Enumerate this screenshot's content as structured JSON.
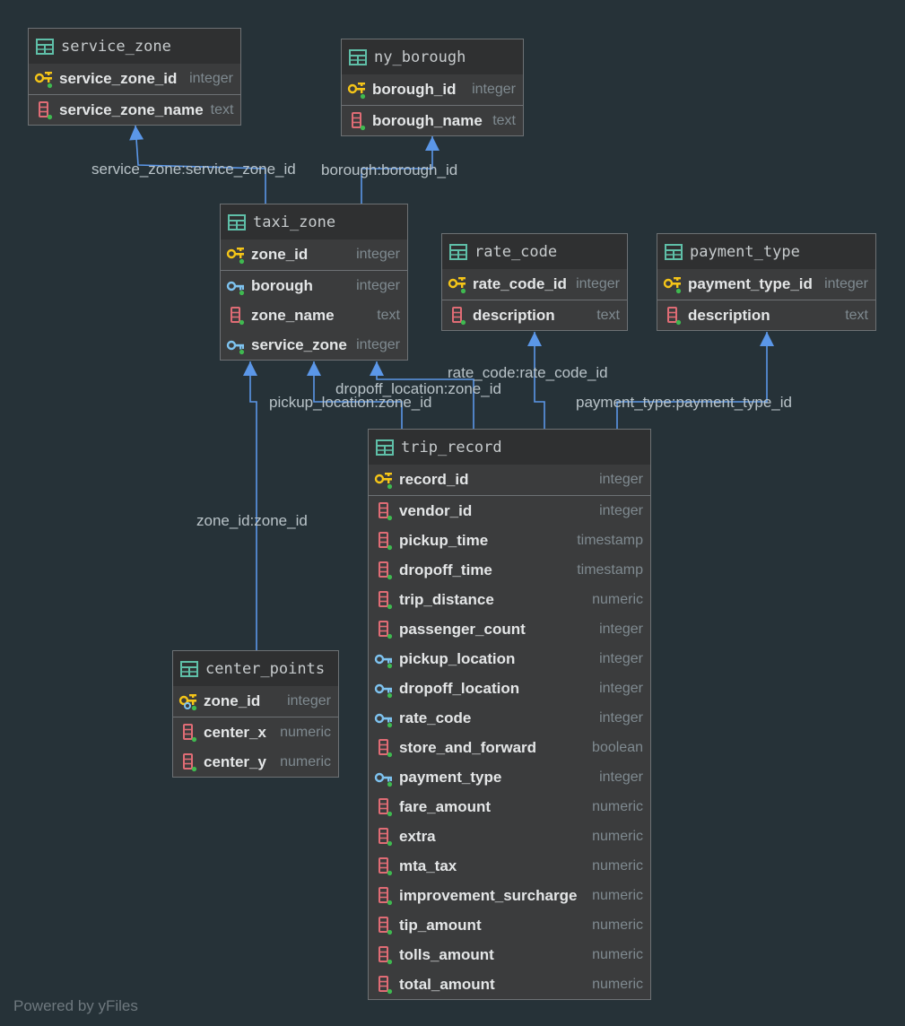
{
  "tables": [
    {
      "key": "service_zone",
      "title": "service_zone",
      "columns": [
        {
          "name": "service_zone_id",
          "type": "integer",
          "kind": "pk"
        },
        {
          "name": "service_zone_name",
          "type": "text",
          "kind": "col"
        }
      ]
    },
    {
      "key": "ny_borough",
      "title": "ny_borough",
      "columns": [
        {
          "name": "borough_id",
          "type": "integer",
          "kind": "pk"
        },
        {
          "name": "borough_name",
          "type": "text",
          "kind": "col"
        }
      ]
    },
    {
      "key": "taxi_zone",
      "title": "taxi_zone",
      "columns": [
        {
          "name": "zone_id",
          "type": "integer",
          "kind": "pk"
        },
        {
          "name": "borough",
          "type": "integer",
          "kind": "fk"
        },
        {
          "name": "zone_name",
          "type": "text",
          "kind": "col"
        },
        {
          "name": "service_zone",
          "type": "integer",
          "kind": "fk"
        }
      ]
    },
    {
      "key": "rate_code",
      "title": "rate_code",
      "columns": [
        {
          "name": "rate_code_id",
          "type": "integer",
          "kind": "pk"
        },
        {
          "name": "description",
          "type": "text",
          "kind": "col"
        }
      ]
    },
    {
      "key": "payment_type",
      "title": "payment_type",
      "columns": [
        {
          "name": "payment_type_id",
          "type": "integer",
          "kind": "pk"
        },
        {
          "name": "description",
          "type": "text",
          "kind": "col"
        }
      ]
    },
    {
      "key": "trip_record",
      "title": "trip_record",
      "columns": [
        {
          "name": "record_id",
          "type": "integer",
          "kind": "pk"
        },
        {
          "name": "vendor_id",
          "type": "integer",
          "kind": "col"
        },
        {
          "name": "pickup_time",
          "type": "timestamp",
          "kind": "col"
        },
        {
          "name": "dropoff_time",
          "type": "timestamp",
          "kind": "col"
        },
        {
          "name": "trip_distance",
          "type": "numeric",
          "kind": "col"
        },
        {
          "name": "passenger_count",
          "type": "integer",
          "kind": "col"
        },
        {
          "name": "pickup_location",
          "type": "integer",
          "kind": "fk"
        },
        {
          "name": "dropoff_location",
          "type": "integer",
          "kind": "fk"
        },
        {
          "name": "rate_code",
          "type": "integer",
          "kind": "fk"
        },
        {
          "name": "store_and_forward",
          "type": "boolean",
          "kind": "col"
        },
        {
          "name": "payment_type",
          "type": "integer",
          "kind": "fk"
        },
        {
          "name": "fare_amount",
          "type": "numeric",
          "kind": "col"
        },
        {
          "name": "extra",
          "type": "numeric",
          "kind": "col"
        },
        {
          "name": "mta_tax",
          "type": "numeric",
          "kind": "col"
        },
        {
          "name": "improvement_surcharge",
          "type": "numeric",
          "kind": "col"
        },
        {
          "name": "tip_amount",
          "type": "numeric",
          "kind": "col"
        },
        {
          "name": "tolls_amount",
          "type": "numeric",
          "kind": "col"
        },
        {
          "name": "total_amount",
          "type": "numeric",
          "kind": "col"
        }
      ]
    },
    {
      "key": "center_points",
      "title": "center_points",
      "columns": [
        {
          "name": "zone_id",
          "type": "integer",
          "kind": "pkfk"
        },
        {
          "name": "center_x",
          "type": "numeric",
          "kind": "col"
        },
        {
          "name": "center_y",
          "type": "numeric",
          "kind": "col"
        }
      ]
    }
  ],
  "relations": [
    {
      "key": "sz",
      "from": "taxi_zone",
      "to": "service_zone",
      "label": "service_zone:service_zone_id"
    },
    {
      "key": "bo",
      "from": "taxi_zone",
      "to": "ny_borough",
      "label": "borough:borough_id"
    },
    {
      "key": "rc",
      "from": "trip_record",
      "to": "rate_code",
      "label": "rate_code:rate_code_id"
    },
    {
      "key": "dl",
      "from": "trip_record",
      "to": "taxi_zone",
      "label": "dropoff_location:zone_id"
    },
    {
      "key": "pl",
      "from": "trip_record",
      "to": "taxi_zone",
      "label": "pickup_location:zone_id"
    },
    {
      "key": "pt",
      "from": "trip_record",
      "to": "payment_type",
      "label": "payment_type:payment_type_id"
    },
    {
      "key": "zi",
      "from": "center_points",
      "to": "taxi_zone",
      "label": "zone_id:zone_id"
    }
  ],
  "footer": "Powered by yFiles",
  "colors": {
    "background": "#263238",
    "edge": "#5b97e8",
    "pk_key": "#f5c518",
    "fk_key": "#7ec3f0",
    "column": "#e06c75",
    "table_icon": "#5fbfa8"
  }
}
